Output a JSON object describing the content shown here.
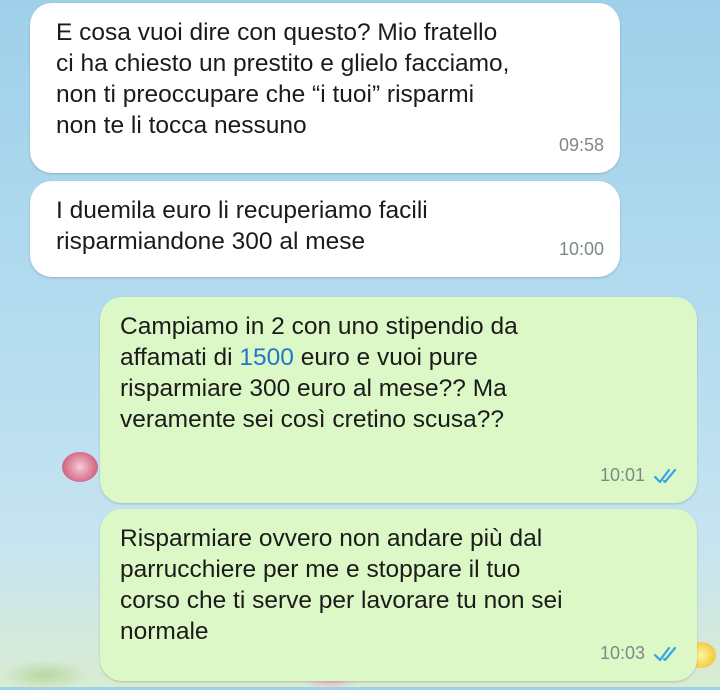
{
  "conversation": {
    "messages": [
      {
        "direction": "incoming",
        "text": "E cosa vuoi dire con questo? Mio fratello\nci ha chiesto un prestito e glielo facciamo,\nnon ti preoccupare che “i tuoi” risparmi\nnon te li tocca nessuno",
        "time": "09:58"
      },
      {
        "direction": "incoming",
        "text": "I duemila euro li recuperiamo facili\nrisparmiandone 300 al mese",
        "time": "10:00"
      },
      {
        "direction": "outgoing",
        "text_before": "Campiamo in 2 con uno stipendio da\naffamati di ",
        "link_number": "1500",
        "text_after": " euro e vuoi pure\nrisparmiare 300 euro al mese?? Ma\nveramente sei così cretino scusa??",
        "time": "10:01",
        "status": "read"
      },
      {
        "direction": "outgoing",
        "text": "Risparmiare ovvero non andare più dal\nparrucchiere per me e stoppare il tuo\ncorso che ti serve per lavorare tu non sei\nnormale",
        "time": "10:03",
        "status": "read"
      }
    ]
  },
  "colors": {
    "incoming_bubble": "#ffffff",
    "outgoing_bubble": "#dcf8c6",
    "read_ticks": "#34a5e8",
    "link": "#1f78c8"
  },
  "icons": {
    "read_receipt": "double-check-icon"
  }
}
